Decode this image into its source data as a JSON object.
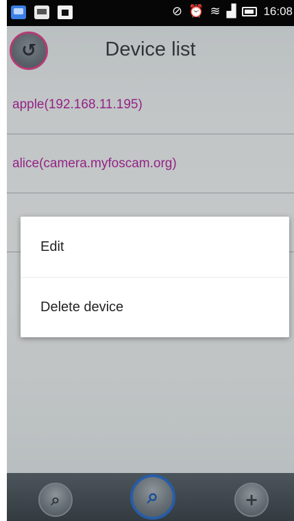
{
  "status_bar": {
    "time": "16:08",
    "left_icons": [
      "notification-app-icon",
      "image-icon",
      "shopping-bag-icon"
    ],
    "right_icons": [
      "mute-icon",
      "alarm-icon",
      "wifi-icon",
      "signal-icon",
      "battery-icon"
    ]
  },
  "header": {
    "title": "Device list",
    "back_icon": "refresh-back-icon"
  },
  "devices": [
    {
      "label": "apple(192.168.11.195)"
    },
    {
      "label": "alice(camera.myfoscam.org)"
    },
    {
      "label": ""
    }
  ],
  "context_menu": {
    "items": [
      {
        "label": "Edit"
      },
      {
        "label": "Delete device"
      }
    ]
  },
  "bottom_bar": {
    "buttons": [
      "search-icon",
      "lan-search-icon",
      "add-icon"
    ]
  },
  "colors": {
    "device_text": "#b02aa0",
    "accent_ring": "#d9468a",
    "search_ring": "#2f6fc9"
  }
}
